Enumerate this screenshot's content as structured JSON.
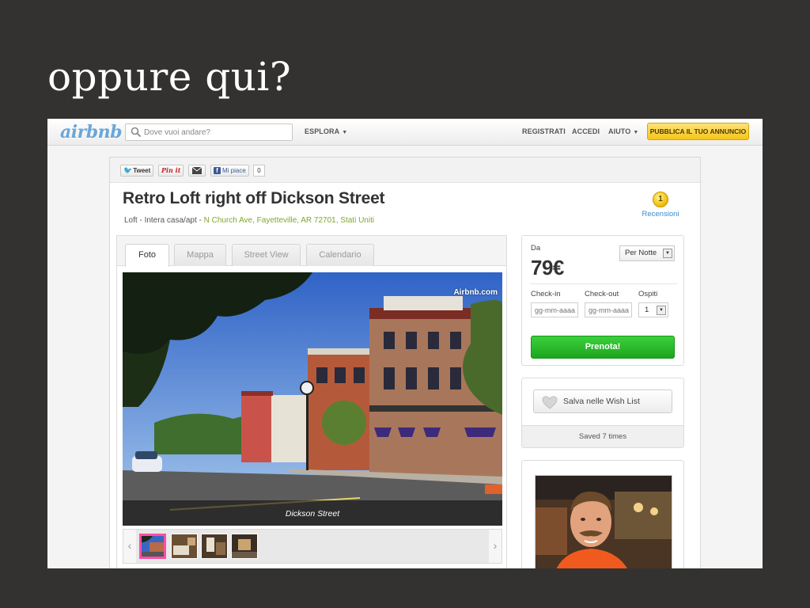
{
  "slide": {
    "title": "oppure qui?"
  },
  "nav": {
    "logo": "airbnb",
    "search_placeholder": "Dove vuoi andare?",
    "explore": "ESPLORA",
    "register": "REGISTRATI",
    "login": "ACCEDI",
    "help": "AIUTO",
    "publish": "PUBBLICA IL TUO ANNUNCIO"
  },
  "share": {
    "tweet": "Tweet",
    "pin": "Pin it",
    "like": "Mi piace",
    "like_count": "0"
  },
  "listing": {
    "title": "Retro Loft right off Dickson Street",
    "type": "Loft - Intera casa/apt",
    "separator": " - ",
    "address": "N Church Ave, Fayetteville, AR 72701, Stati Uniti",
    "review_count": "1",
    "reviews_label": "Recensioni"
  },
  "tabs": [
    "Foto",
    "Mappa",
    "Street View",
    "Calendario"
  ],
  "photo": {
    "watermark": "Airbnb.com",
    "caption": "Dickson Street"
  },
  "booking": {
    "from_label": "Da",
    "price": "79€",
    "per_option": "Per Notte",
    "checkin_label": "Check-in",
    "checkout_label": "Check-out",
    "guests_label": "Ospiti",
    "date_placeholder": "gg-mm-aaaa",
    "guests_value": "1",
    "book_button": "Prenota!"
  },
  "wishlist": {
    "save_button": "Salva nelle Wish List",
    "saved_text": "Saved 7 times"
  },
  "colors": {
    "background": "#333230",
    "book_green": "#2dbb2d",
    "publish_yellow": "#f5c518",
    "link_blue": "#3a8bc9",
    "address_green": "#7fa630",
    "thumb_active": "#ff4da6"
  }
}
